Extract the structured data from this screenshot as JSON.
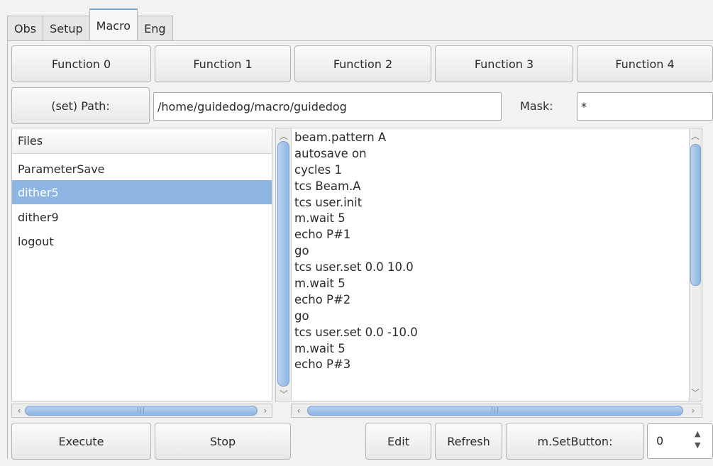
{
  "tabs": [
    {
      "label": "Obs"
    },
    {
      "label": "Setup"
    },
    {
      "label": "Macro"
    },
    {
      "label": "Eng"
    }
  ],
  "functions": [
    "Function 0",
    "Function 1",
    "Function 2",
    "Function 3",
    "Function 4"
  ],
  "path": {
    "button_label": "(set) Path:",
    "value": "/home/guidedog/macro/guidedog",
    "mask_label": "Mask:",
    "mask_value": "*"
  },
  "files": {
    "header": "Files",
    "items": [
      "ParameterSave",
      "dither5",
      "dither9",
      "logout"
    ],
    "selected": "dither5"
  },
  "editor_lines": [
    "beam.pattern A",
    "autosave on",
    "cycles 1",
    "tcs Beam.A",
    "tcs user.init",
    "m.wait 5",
    "echo P#1",
    "go",
    "tcs user.set 0.0 10.0",
    "m.wait 5",
    "echo P#2",
    "go",
    "tcs user.set 0.0 -10.0",
    "m.wait 5",
    "echo P#3"
  ],
  "bottom": {
    "execute": "Execute",
    "stop": "Stop",
    "edit": "Edit",
    "refresh": "Refresh",
    "setbutton": "m.SetButton:",
    "spin_value": "0"
  },
  "colors": {
    "selection": "#8fb5e3",
    "active_tab_accent": "#7aa3d4"
  }
}
